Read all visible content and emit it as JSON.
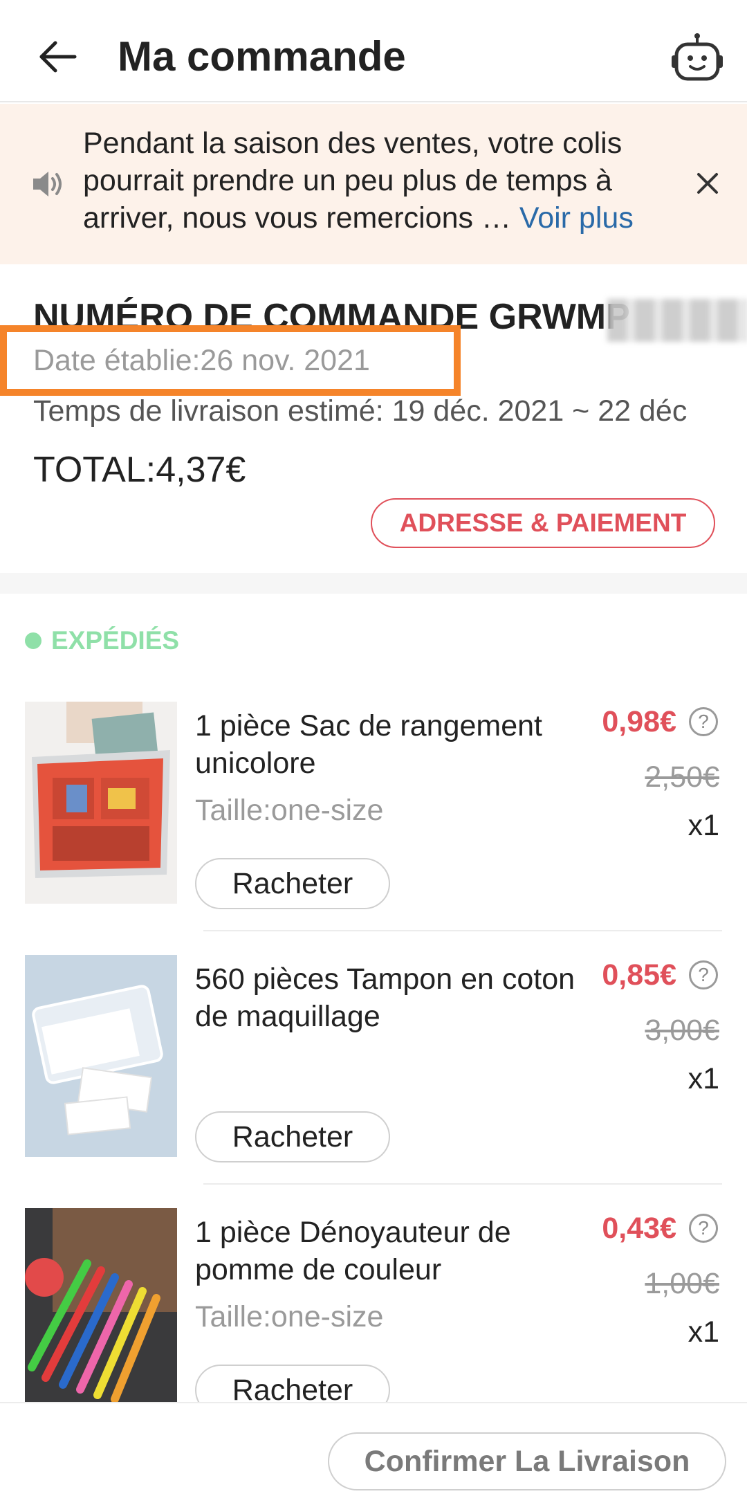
{
  "header": {
    "title": "Ma commande"
  },
  "notice": {
    "text": "Pendant la saison des ventes, votre colis pourrait prendre un peu plus de temps à arriver, nous vous remercions … ",
    "more_link": "Voir plus"
  },
  "order": {
    "number_label": "NUMÉRO DE COMMANDE GRWMP",
    "date_label": "Date établie:26 nov. 2021",
    "delivery_estimate": "Temps de livraison estimé: 19 déc. 2021 ~ 22 déc",
    "total": "TOTAL:4,37€",
    "address_button": "ADRESSE & PAIEMENT"
  },
  "status": {
    "label": "EXPÉDIÉS"
  },
  "products": [
    {
      "name": "1 pièce Sac de rangement unicolore",
      "size": "Taille:one-size",
      "price": "0,98€",
      "old_price": "2,50€",
      "qty": "x1",
      "rebuy": "Racheter"
    },
    {
      "name": "560 pièces Tampon en coton de maquillage",
      "size": "",
      "price": "0,85€",
      "old_price": "3,00€",
      "qty": "x1",
      "rebuy": "Racheter"
    },
    {
      "name": "1 pièce Dénoyauteur de pomme de couleur",
      "size": "Taille:one-size",
      "price": "0,43€",
      "old_price": "1,00€",
      "qty": "x1",
      "rebuy": "Racheter"
    }
  ],
  "footer": {
    "confirm_button": "Confirmer La Livraison"
  },
  "colors": {
    "accent_red": "#e0505a",
    "status_green": "#8fe0a8",
    "link_blue": "#2a6aa8",
    "highlight_orange": "#f5842a",
    "notice_bg": "#fdf2ea"
  }
}
